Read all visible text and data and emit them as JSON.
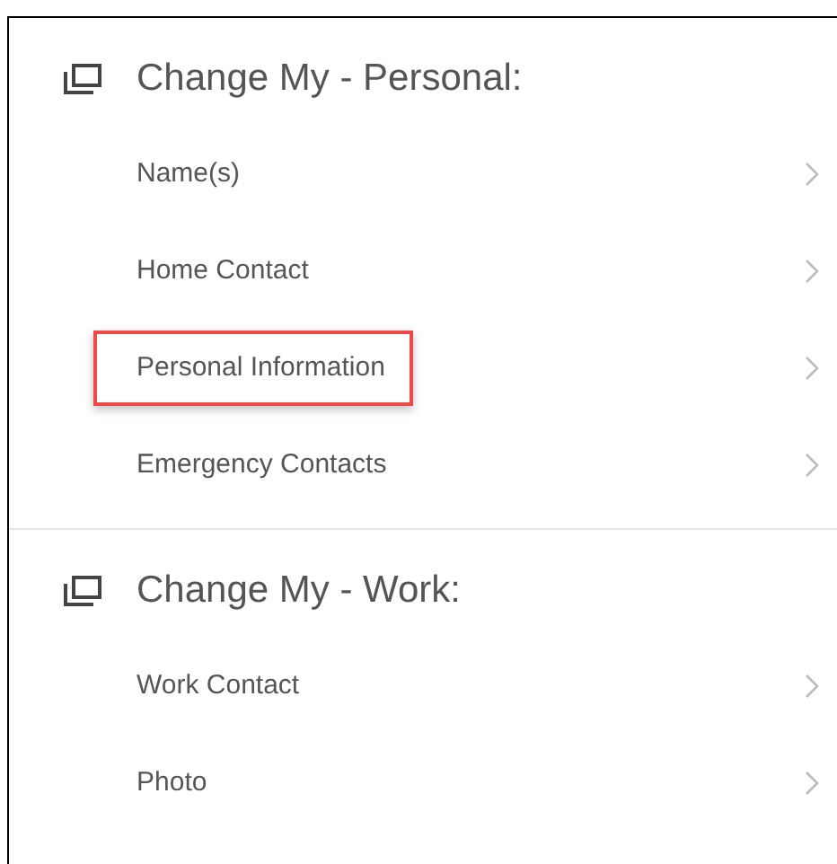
{
  "sections": [
    {
      "title": "Change My - Personal:",
      "items": [
        {
          "label": "Name(s)",
          "highlighted": false
        },
        {
          "label": "Home Contact",
          "highlighted": false
        },
        {
          "label": "Personal Information",
          "highlighted": true
        },
        {
          "label": "Emergency Contacts",
          "highlighted": false
        }
      ]
    },
    {
      "title": "Change My - Work:",
      "items": [
        {
          "label": "Work Contact",
          "highlighted": false
        },
        {
          "label": "Photo",
          "highlighted": false
        }
      ]
    }
  ]
}
